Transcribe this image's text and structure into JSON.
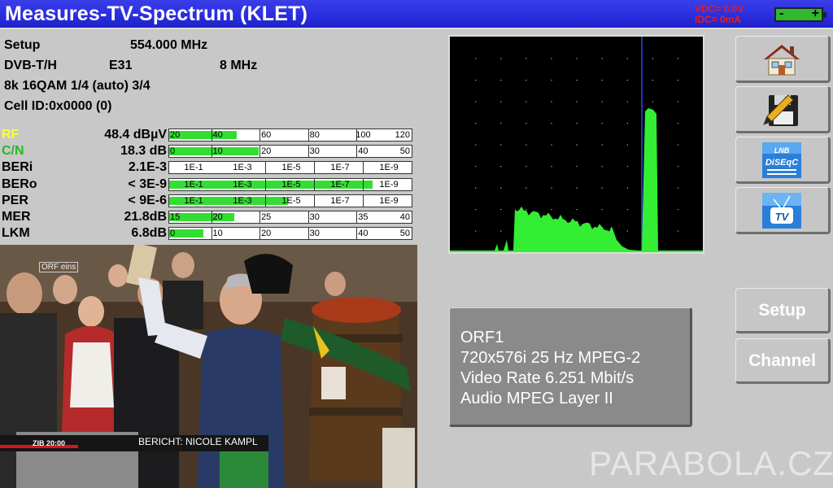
{
  "header": {
    "title": "Measures-TV-Spectrum (KLET)",
    "vdc": "VDC= 0.0V",
    "idc": "IDC= 0mA",
    "battery_minus": "-",
    "battery_plus": "+"
  },
  "info": {
    "mode": "Setup",
    "frequency": "554.000 MHz",
    "standard": "DVB-T/H",
    "channel": "E31",
    "bandwidth": "8 MHz",
    "modulation": "8k 16QAM 1/4 (auto) 3/4",
    "cell_id": "Cell ID:0x0000 (0)"
  },
  "measurements": [
    {
      "label": "RF",
      "label_color": "#ffff33",
      "value": "48.4 dBµV",
      "fill_fraction": 0.28,
      "ticks": [
        "20",
        "40",
        "60",
        "80",
        "100",
        "120"
      ]
    },
    {
      "label": "C/N",
      "label_color": "#22bb22",
      "value": "18.3 dB",
      "fill_fraction": 0.37,
      "ticks": [
        "0",
        "10",
        "20",
        "30",
        "40",
        "50"
      ]
    },
    {
      "label": "BERi",
      "label_color": "#000000",
      "value": "2.1E-3",
      "fill_fraction": 0.0,
      "ticks": [
        "1E-1",
        "1E-3",
        "1E-5",
        "1E-7",
        "1E-9"
      ]
    },
    {
      "label": "BERo",
      "label_color": "#000000",
      "value": "< 3E-9",
      "fill_fraction": 0.84,
      "ticks": [
        "1E-1",
        "1E-3",
        "1E-5",
        "1E-7",
        "1E-9"
      ]
    },
    {
      "label": "PER",
      "label_color": "#000000",
      "value": "< 9E-6",
      "fill_fraction": 0.49,
      "ticks": [
        "1E-1",
        "1E-3",
        "1E-5",
        "1E-7",
        "1E-9"
      ]
    },
    {
      "label": "MER",
      "label_color": "#000000",
      "value": "21.8dB",
      "fill_fraction": 0.27,
      "ticks": [
        "15",
        "20",
        "25",
        "30",
        "35",
        "40"
      ]
    },
    {
      "label": "LKM",
      "label_color": "#000000",
      "value": "6.8dB",
      "fill_fraction": 0.14,
      "ticks": [
        "0",
        "10",
        "20",
        "30",
        "40",
        "50"
      ]
    }
  ],
  "video": {
    "channel_logo": "ORF eins",
    "news_tag": "ZIB 20:00",
    "caption": "BERICHT: NICOLE KAMPL"
  },
  "side_buttons": [
    {
      "name": "home-button",
      "icon": "house-icon"
    },
    {
      "name": "save-button",
      "icon": "floppy-pencil-icon"
    },
    {
      "name": "diseqc-button",
      "icon": "lnb-diseqc-icon",
      "line1": "LNB",
      "line2": "DiSEqC"
    },
    {
      "name": "tv-button",
      "icon": "tv-icon",
      "text": "TV"
    }
  ],
  "buttons": {
    "setup": "Setup",
    "channel": "Channel"
  },
  "service": {
    "name": "ORF1",
    "video_format": "720x576i 25 Hz MPEG-2",
    "video_rate": "Video Rate 6.251 Mbit/s",
    "audio": "Audio MPEG Layer II"
  },
  "watermark": "PARABOLA.CZ",
  "colors": {
    "accent": "#2a2edf",
    "meter_fill": "#33dd33",
    "spectrum_trace": "#33ee33",
    "marker": "#3344ff"
  }
}
